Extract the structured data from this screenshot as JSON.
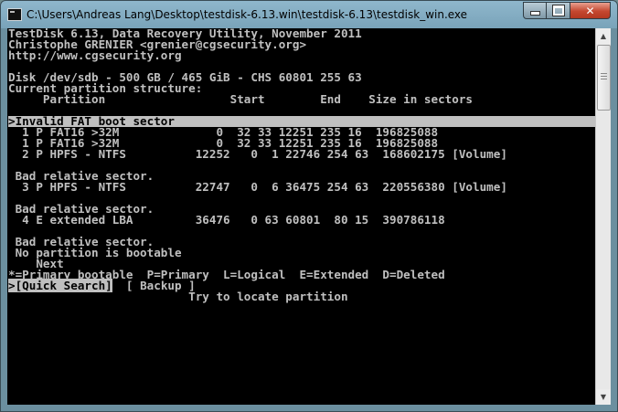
{
  "window": {
    "title": "C:\\Users\\Andreas Lang\\Desktop\\testdisk-6.13.win\\testdisk-6.13\\testdisk_win.exe",
    "minimize_icon": "minimize-icon",
    "maximize_icon": "maximize-icon",
    "close_icon": "close-icon",
    "close_glyph": "✕"
  },
  "console": {
    "header": [
      "TestDisk 6.13, Data Recovery Utility, November 2011",
      "Christophe GRENIER <grenier@cgsecurity.org>",
      "http://www.cgsecurity.org"
    ],
    "disk_line": "Disk /dev/sdb - 500 GB / 465 GiB - CHS 60801 255 63",
    "structure_title": "Current partition structure:",
    "columns_line": "     Partition                  Start        End    Size in sectors",
    "selected_line": ">Invalid FAT boot sector                                                ",
    "partitions": [
      "  1 P FAT16 >32M              0  32 33 12251 235 16  196825088",
      "  1 P FAT16 >32M              0  32 33 12251 235 16  196825088",
      "  2 P HPFS - NTFS          12252   0  1 22746 254 63  168602175 [Volume]"
    ],
    "bad_sector_1": " Bad relative sector.",
    "partition_3": "  3 P HPFS - NTFS          22747   0  6 36475 254 63  220556380 [Volume]",
    "bad_sector_2": " Bad relative sector.",
    "partition_4": "  4 E extended LBA         36476   0 63 60801  80 15  390786118",
    "bad_sector_3": " Bad relative sector.",
    "not_bootable": " No partition is bootable",
    "next_label": "    Next",
    "legend_line": "*=Primary bootable  P=Primary  L=Logical  E=Extended  D=Deleted",
    "quick_search_label": ">[Quick Search]",
    "backup_label": "[ Backup ]",
    "hint": "Try to locate partition"
  },
  "scrollbar": {
    "up_arrow": "▲",
    "down_arrow": "▼"
  }
}
